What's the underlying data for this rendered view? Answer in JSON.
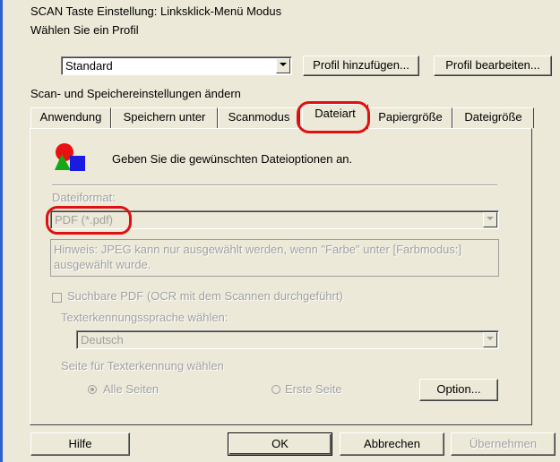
{
  "dialog": {
    "title_line": "SCAN Taste Einstellung: Linksklick-Menü Modus",
    "profile_label": "Wählen Sie ein Profil",
    "profile_value": "Standard",
    "add_profile_button": "Profil hinzufügen...",
    "edit_profile_button": "Profil bearbeiten...",
    "section_label": "Scan- und Speichereinstellungen ändern"
  },
  "tabs": [
    {
      "label": "Anwendung"
    },
    {
      "label": "Speichern unter"
    },
    {
      "label": "Scanmodus"
    },
    {
      "label": "Dateiart",
      "active": true
    },
    {
      "label": "Papiergröße"
    },
    {
      "label": "Dateigröße"
    }
  ],
  "panel": {
    "header_text": "Geben Sie die gewünschten Dateioptionen an.",
    "file_format_label": "Dateiformat:",
    "file_format_value": "PDF (*.pdf)",
    "hint_text": "Hinweis: JPEG kann nur ausgewählt werden, wenn \"Farbe\" unter [Farbmodus:] ausgewählt wurde.",
    "searchable_pdf_label": "Suchbare PDF (OCR mit dem Scannen durchgeführt)",
    "ocr_language_label": "Texterkennungssprache wählen:",
    "ocr_language_value": "Deutsch",
    "page_select_label": "Seite für Texterkennung wählen",
    "radio_all_pages": "Alle Seiten",
    "radio_first_page": "Erste Seite",
    "option_button": "Option..."
  },
  "footer": {
    "help_button": "Hilfe",
    "ok_button": "OK",
    "cancel_button": "Abbrechen",
    "apply_button": "Übernehmen"
  },
  "colors": {
    "highlight": "#e01010",
    "dialog_bg": "#ece9d8",
    "accent_bar": "#2f5fd0"
  }
}
